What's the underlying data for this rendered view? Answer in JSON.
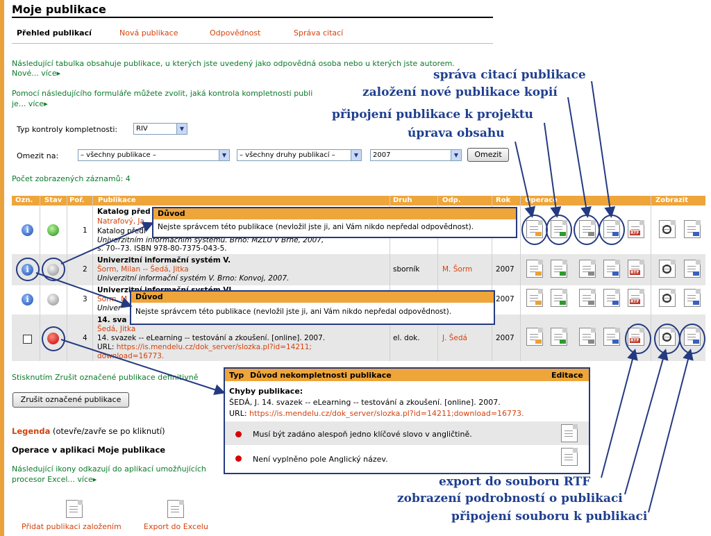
{
  "page_title": "Moje publikace",
  "tabs": [
    {
      "label": "Přehled publikací"
    },
    {
      "label": "Nová publikace"
    },
    {
      "label": "Odpovědnost"
    },
    {
      "label": "Správa citací"
    }
  ],
  "intro": {
    "text": "Následující tabulka obsahuje publikace, u kterých jste uvedený jako odpovědná osoba nebo u kterých jste autorem.",
    "more": "Nové... více"
  },
  "form_intro": {
    "text": "Pomocí následujícího formuláře můžete zvolit, jaká kontrola kompletnosti publi",
    "more": "je... více"
  },
  "filters": {
    "check_label": "Typ kontroly kompletnosti:",
    "check_value": "RIV",
    "limit_label": "Omezit na:",
    "pub_value": "– všechny publikace –",
    "type_value": "– všechny druhy publikací –",
    "year_value": "2007",
    "limit_button": "Omezit"
  },
  "count_text": "Počet zobrazených záznamů: 4",
  "table": {
    "headers": [
      "Ozn.",
      "Stav",
      "Poř.",
      "Publikace",
      "Druh",
      "Odp.",
      "Rok",
      "Operace",
      "Zobrazit"
    ],
    "rows": [
      {
        "num": "1",
        "title": "Katalog před",
        "authors": "Natrafový, Ja",
        "citation": "Katalog předl",
        "citation2": "Univerzitním informačním systému. Brno: MZLU v Brně, 2007,",
        "citation3": "s. 70--73. ISBN 978-80-7375-043-5.",
        "type": "",
        "resp": "",
        "year": ""
      },
      {
        "num": "2",
        "title": "Univerzitní informační systém V.",
        "authors": "Šorm, Milan -- Šedá, Jitka",
        "citation": "Univerzitní informační systém V. Brno: Konvoj, 2007.",
        "type": "sborník",
        "resp": "M. Šorm",
        "year": "2007"
      },
      {
        "num": "3",
        "title": "Univerzitní informační systém VI",
        "authors": "Šorm, M",
        "citation": "Univer",
        "type": "",
        "resp": "",
        "year": "2007"
      },
      {
        "num": "4",
        "title": "14. sva",
        "authors": "Šedá, Jitka",
        "citation": "14. svazek -- eLearning -- testování a zkoušení. [online]. 2007.",
        "citation2": "URL: ",
        "url": "https://is.mendelu.cz/dok_server/slozka.pl?id=14211;",
        "url2": "download=16773.",
        "type": "el. dok.",
        "resp": "J. Šedá",
        "year": "2007"
      }
    ]
  },
  "reason_popup": {
    "title": "Důvod",
    "text": "Nejste správcem této publikace (nevložil jste ji, ani Vám nikdo nepředal odpovědnost)."
  },
  "incomplete_popup": {
    "headers": [
      "Typ",
      "Důvod nekompletnosti publikace",
      "Editace"
    ],
    "errors_title": "Chyby publikace:",
    "citation": "ŠEDÁ, J. 14. svazek -- eLearning -- testování a zkoušení.  [online]. 2007.",
    "url_label": "URL: ",
    "url": "https://is.mendelu.cz/dok_server/slozka.pl?id=14211;download=16773.",
    "items": [
      "Musí být zadáno alespoň jedno klíčové slovo v angličtině.",
      "Není vyplněno pole Anglický název."
    ]
  },
  "delete": {
    "text": "Stisknutím Zrušit označené publikace definitivně",
    "button": "Zrušit označené publikace"
  },
  "legend": {
    "title": "Legenda",
    "note": " (otevře/zavře se po kliknutí)"
  },
  "ops": {
    "title": "Operace v aplikaci Moje publikace",
    "text": "Následující ikony odkazují do aplikací umožňujících",
    "text2": "procesor Excel... více",
    "add_label": "Přidat publikaci založením",
    "export_label": "Export do Excelu"
  },
  "annotations": {
    "a1": "správa citací publikace",
    "a2": "založení nové publikace kopií",
    "a3": "připojení publikace k projektu",
    "a4": "úprava obsahu",
    "a5": "export do souboru RTF",
    "a6": "zobrazení podrobností o publikaci",
    "a7": "připojení souboru k publikaci"
  },
  "colors": {
    "accent": "#eea53a",
    "link": "#d4420c",
    "green_text": "#0a7a2a",
    "annotation": "#1f3f8f"
  },
  "icon_labels": {
    "rtf": "RTF"
  }
}
